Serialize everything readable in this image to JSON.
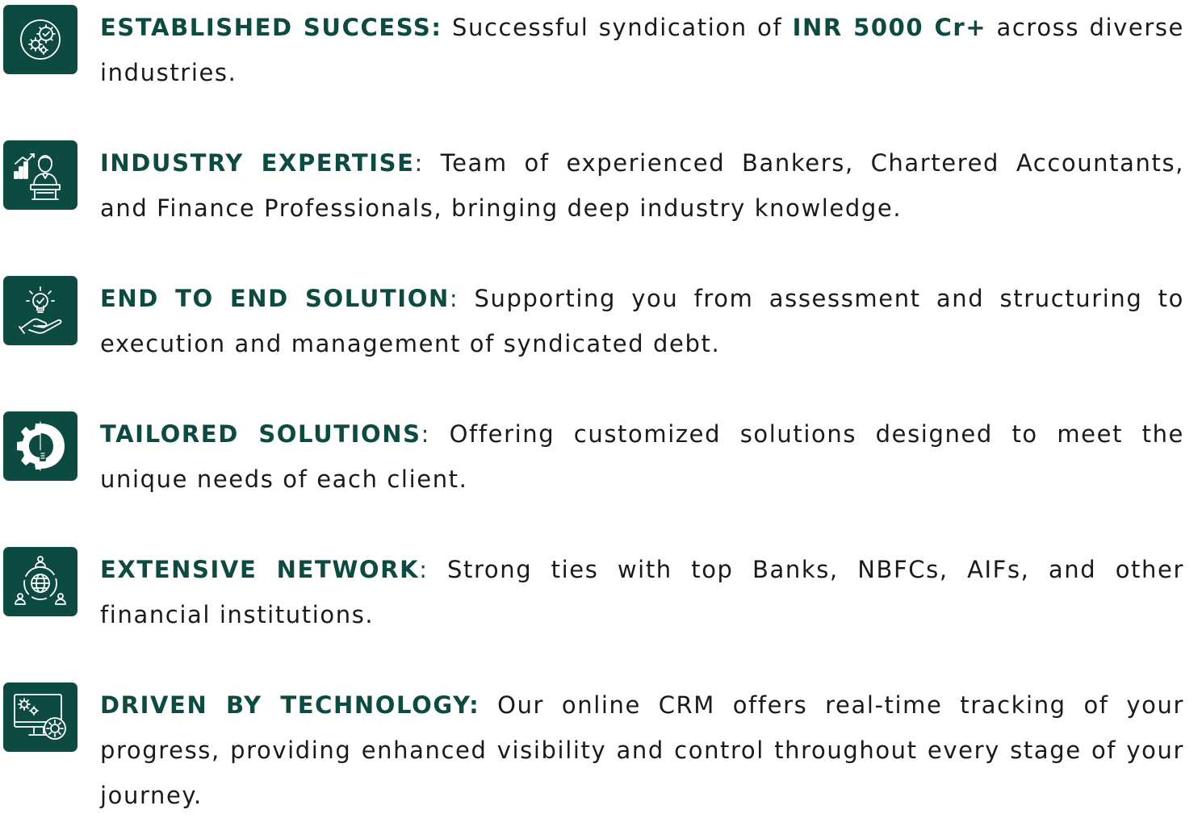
{
  "features": [
    {
      "icon": "gears-check-icon",
      "heading": "ESTABLISHED SUCCESS:",
      "sep": "",
      "body_pre": " Successful syndication of ",
      "highlight": "INR 5000 Cr+",
      "body_post": " across diverse industries."
    },
    {
      "icon": "businessman-podium-icon",
      "heading": "INDUSTRY EXPERTISE",
      "sep": ":",
      "body_pre": " Team of experienced Bankers, Chartered Accountants, and Finance Professionals, bringing deep industry knowledge.",
      "highlight": "",
      "body_post": ""
    },
    {
      "icon": "lightbulb-hand-icon",
      "heading": "END TO END SOLUTION",
      "sep": ":",
      "body_pre": " Supporting you from assessment and structuring to execution and management of syndicated debt.",
      "highlight": "",
      "body_post": ""
    },
    {
      "icon": "gear-bulb-icon",
      "heading": "TAILORED SOLUTIONS",
      "sep": ":",
      "body_pre": " Offering customized solutions designed to meet the unique needs of each client.",
      "highlight": "",
      "body_post": ""
    },
    {
      "icon": "globe-network-icon",
      "heading": "EXTENSIVE NETWORK",
      "sep": ":",
      "body_pre": " Strong ties with top Banks, NBFCs, AIFs, and other financial institutions.",
      "highlight": "",
      "body_post": ""
    },
    {
      "icon": "monitor-gears-icon",
      "heading": "DRIVEN BY TECHNOLOGY:",
      "sep": "",
      "body_pre": " Our online CRM offers real-time tracking of your progress, providing enhanced visibility and control throughout every stage of your journey.",
      "highlight": "",
      "body_post": ""
    }
  ],
  "colors": {
    "accent": "#0d4a42",
    "text": "#1a1a1a",
    "icon_stroke": "#ffffff"
  }
}
